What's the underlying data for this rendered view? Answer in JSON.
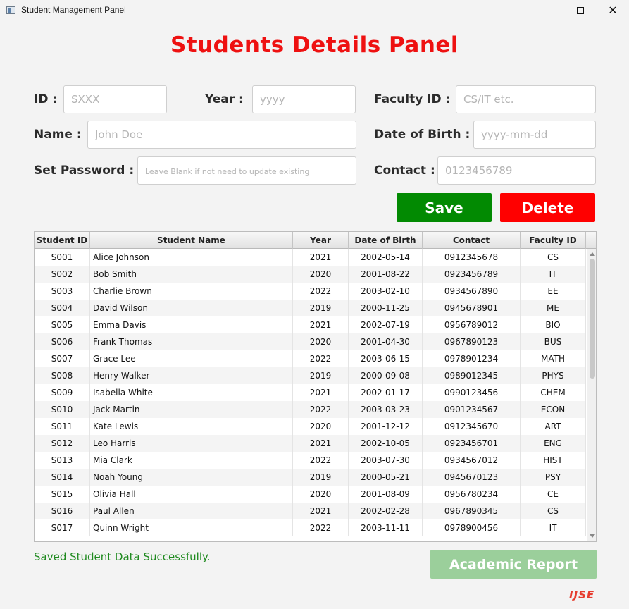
{
  "window": {
    "title": "Student Management Panel",
    "close_glyph": "✕"
  },
  "page_title": "Students Details Panel",
  "form": {
    "id_label": "ID :",
    "id_placeholder": "SXXX",
    "year_label": "Year :",
    "year_placeholder": "yyyy",
    "faculty_label": "Faculty ID :",
    "faculty_placeholder": "CS/IT etc.",
    "name_label": "Name :",
    "name_placeholder": "John Doe",
    "dob_label": "Date of Birth :",
    "dob_placeholder": "yyyy-mm-dd",
    "password_label": "Set Password :",
    "password_placeholder": "Leave Blank if not need to update existing",
    "contact_label": "Contact :",
    "contact_placeholder": "0123456789"
  },
  "buttons": {
    "save": "Save",
    "delete": "Delete",
    "report": "Academic Report"
  },
  "table": {
    "columns": [
      "Student ID",
      "Student Name",
      "Year",
      "Date of Birth",
      "Contact",
      "Faculty ID"
    ],
    "rows": [
      [
        "S001",
        "Alice Johnson",
        "2021",
        "2002-05-14",
        "0912345678",
        "CS"
      ],
      [
        "S002",
        "Bob Smith",
        "2020",
        "2001-08-22",
        "0923456789",
        "IT"
      ],
      [
        "S003",
        "Charlie Brown",
        "2022",
        "2003-02-10",
        "0934567890",
        "EE"
      ],
      [
        "S004",
        "David Wilson",
        "2019",
        "2000-11-25",
        "0945678901",
        "ME"
      ],
      [
        "S005",
        "Emma Davis",
        "2021",
        "2002-07-19",
        "0956789012",
        "BIO"
      ],
      [
        "S006",
        "Frank Thomas",
        "2020",
        "2001-04-30",
        "0967890123",
        "BUS"
      ],
      [
        "S007",
        "Grace Lee",
        "2022",
        "2003-06-15",
        "0978901234",
        "MATH"
      ],
      [
        "S008",
        "Henry Walker",
        "2019",
        "2000-09-08",
        "0989012345",
        "PHYS"
      ],
      [
        "S009",
        "Isabella White",
        "2021",
        "2002-01-17",
        "0990123456",
        "CHEM"
      ],
      [
        "S010",
        "Jack Martin",
        "2022",
        "2003-03-23",
        "0901234567",
        "ECON"
      ],
      [
        "S011",
        "Kate Lewis",
        "2020",
        "2001-12-12",
        "0912345670",
        "ART"
      ],
      [
        "S012",
        "Leo Harris",
        "2021",
        "2002-10-05",
        "0923456701",
        "ENG"
      ],
      [
        "S013",
        "Mia Clark",
        "2022",
        "2003-07-30",
        "0934567012",
        "HIST"
      ],
      [
        "S014",
        "Noah Young",
        "2019",
        "2000-05-21",
        "0945670123",
        "PSY"
      ],
      [
        "S015",
        "Olivia Hall",
        "2020",
        "2001-08-09",
        "0956780234",
        "CE"
      ],
      [
        "S016",
        "Paul Allen",
        "2021",
        "2002-02-28",
        "0967890345",
        "CS"
      ],
      [
        "S017",
        "Quinn Wright",
        "2022",
        "2003-11-11",
        "0978900456",
        "IT"
      ]
    ]
  },
  "status": "Saved Student Data Successfully.",
  "logo_text": "IJSE",
  "colors": {
    "title_red": "#ee1111",
    "save_green": "#028a02",
    "delete_red": "#ff0000",
    "report_green_disabled": "#9bcf9b",
    "status_green": "#1f8a1f",
    "logo_red": "#e63c2e"
  }
}
